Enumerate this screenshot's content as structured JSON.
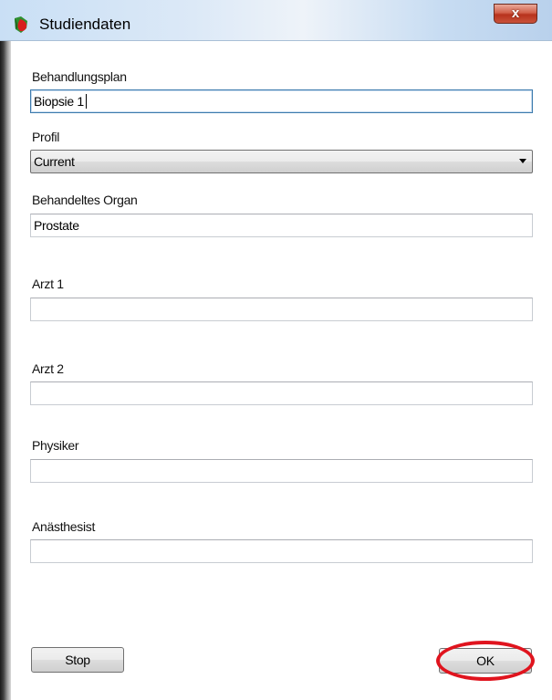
{
  "window": {
    "title": "Studiendaten",
    "close_glyph": "x"
  },
  "form": {
    "treatment_plan": {
      "label": "Behandlungsplan",
      "value": "Biopsie 1"
    },
    "profile": {
      "label": "Profil",
      "selected": "Current"
    },
    "organ": {
      "label": "Behandeltes Organ",
      "value": "Prostate"
    },
    "doctor1": {
      "label": "Arzt 1",
      "value": ""
    },
    "doctor2": {
      "label": "Arzt 2",
      "value": ""
    },
    "physicist": {
      "label": "Physiker",
      "value": ""
    },
    "anesthetist": {
      "label": "Anästhesist",
      "value": ""
    }
  },
  "buttons": {
    "stop_label": "Stop",
    "ok_label": "OK"
  },
  "colors": {
    "highlight": "#e0141e",
    "focus_border": "#3d7bad",
    "close_button": "#c9523a"
  }
}
